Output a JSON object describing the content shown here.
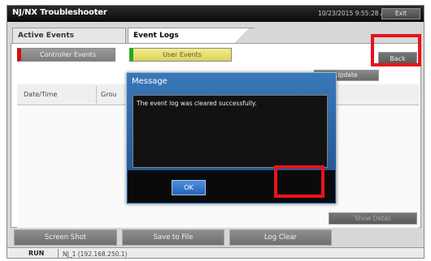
{
  "app": {
    "title": "NJ/NX Troubleshooter",
    "datetime": "10/23/2015 9:55:28 AM",
    "exit_label": "Exit"
  },
  "tabs": [
    {
      "label": "Active Events",
      "active": false
    },
    {
      "label": "Event Logs",
      "active": true
    }
  ],
  "filters": {
    "controller_events_label": "Controller Events",
    "user_events_label": "User Events"
  },
  "toolbar": {
    "back_label": "Back",
    "update_label": "Update"
  },
  "table": {
    "columns": [
      "Date/Time",
      "Grou"
    ]
  },
  "actions": {
    "show_detail_label": "Show Detail",
    "screen_shot_label": "Screen Shot",
    "save_to_file_label": "Save to File",
    "log_clear_label": "Log Clear"
  },
  "status": {
    "mode": "RUN",
    "connection": "NJ_1 (192.168.250.1)"
  },
  "dialog": {
    "title": "Message",
    "message": "The event log was cleared successfully.",
    "ok_label": "OK"
  },
  "colors": {
    "highlight": "#e8141a",
    "dialog_header": "#3a78b8",
    "controller_marker": "#cc1111",
    "user_marker": "#22aa22"
  }
}
